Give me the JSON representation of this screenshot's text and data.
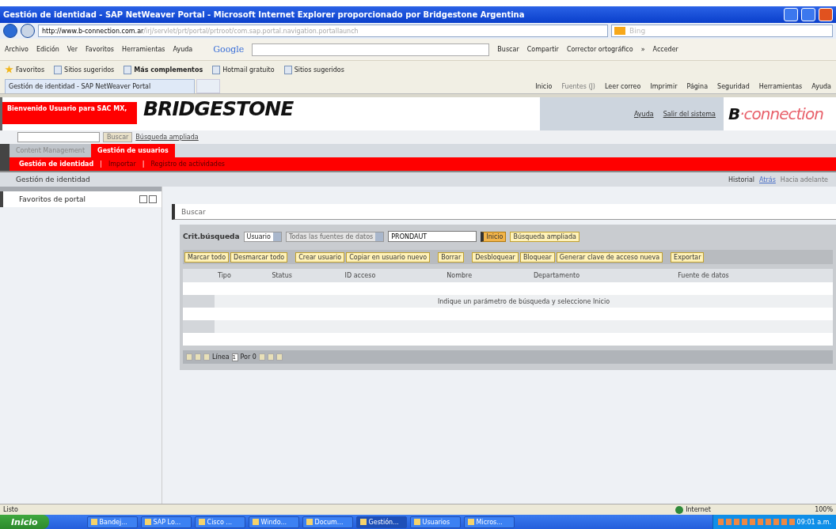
{
  "window": {
    "title": "Gestión de identidad - SAP NetWeaver Portal - Microsoft Internet Explorer proporcionado por Bridgestone Argentina"
  },
  "address_bar": {
    "url_host": "http://www.b-connection.com.ar",
    "url_path": "/irj/servlet/prt/portal/prtroot/com.sap.portal.navigation.portallaunch",
    "search_placeholder": "Bing"
  },
  "menu": [
    "Archivo",
    "Edición",
    "Ver",
    "Favoritos",
    "Herramientas",
    "Ayuda"
  ],
  "google_bar": {
    "brand": "Google",
    "items": [
      "Buscar",
      "Compartir",
      "Corrector ortográfico",
      "»",
      "Acceder"
    ]
  },
  "favorites_bar": [
    {
      "label": "Favoritos",
      "bold": false
    },
    {
      "label": "Sitios sugeridos",
      "bold": false
    },
    {
      "label": "Más complementos",
      "bold": true
    },
    {
      "label": "Hotmail gratuito",
      "bold": false
    },
    {
      "label": "Sitios sugeridos",
      "bold": false
    }
  ],
  "browser_tab": {
    "title": "Gestión de identidad - SAP NetWeaver Portal"
  },
  "command_bar": [
    {
      "label": "Inicio",
      "disabled": false
    },
    {
      "label": "Fuentes (J)",
      "disabled": true
    },
    {
      "label": "Leer correo",
      "disabled": false
    },
    {
      "label": "Imprimir",
      "disabled": false
    },
    {
      "label": "Página",
      "disabled": false
    },
    {
      "label": "Seguridad",
      "disabled": false
    },
    {
      "label": "Herramientas",
      "disabled": false
    },
    {
      "label": "Ayuda",
      "disabled": false
    }
  ],
  "portal_header": {
    "welcome": "Bienvenido Usuario para SAC MX,",
    "logo": "BRIDGESTONE",
    "links": [
      "Ayuda",
      "Salir del sistema"
    ],
    "brand_b": "B",
    "brand_rest": "·connection"
  },
  "portal_search": {
    "button": "Buscar",
    "link": "Búsqueda ampliada"
  },
  "top_tabs": [
    {
      "label": "Content Management",
      "selected": false
    },
    {
      "label": "Gestión de usuarios",
      "selected": true
    }
  ],
  "sub_tab_separator": "|",
  "sub_tabs": [
    {
      "label": "Gestión de identidad",
      "selected": true
    },
    {
      "label": "Importar",
      "selected": false
    },
    {
      "label": "Registro de actividades",
      "selected": false
    }
  ],
  "page_title": "Gestión de identidad",
  "history": [
    {
      "label": "Historial",
      "disabled": false
    },
    {
      "label": "Atrás",
      "disabled": false
    },
    {
      "label": "Hacia adelante",
      "disabled": true
    }
  ],
  "sidebar": {
    "title": "Favoritos de portal"
  },
  "search_panel": {
    "title": "Buscar",
    "criteria_label": "Crit.búsqueda",
    "type": "Usuario",
    "source": "Todas las fuentes de datos",
    "value": "PRONDAUT",
    "go": "Inicio",
    "advanced": "Búsqueda ampliada"
  },
  "actions": [
    [
      "Marcar todo",
      "Desmarcar todo"
    ],
    [
      "Crear usuario",
      "Copiar en usuario nuevo"
    ],
    [
      "Borrar"
    ],
    [
      "Desbloquear",
      "Bloquear",
      "Generar clave de acceso nueva"
    ],
    [
      "Exportar"
    ]
  ],
  "table": {
    "columns": [
      "Tipo",
      "Status",
      "ID acceso",
      "Nombre",
      "Departamento",
      "Fuente de datos"
    ],
    "message": "Indique un parámetro de búsqueda y seleccione Inicio"
  },
  "pager": {
    "label": "Línea",
    "value": "1",
    "total": "Por 0"
  },
  "status_bar": {
    "text": "Listo",
    "zone": "Internet",
    "zoom": "100%"
  },
  "taskbar": {
    "start": "Inicio",
    "items": [
      {
        "label": "Bandej...",
        "selected": false
      },
      {
        "label": "SAP Lo...",
        "selected": false
      },
      {
        "label": "Cisco ...",
        "selected": false
      },
      {
        "label": "Windo...",
        "selected": false
      },
      {
        "label": "Docum...",
        "selected": false
      },
      {
        "label": "Gestión...",
        "selected": true
      },
      {
        "label": "Usuarios",
        "selected": false
      },
      {
        "label": "Micros...",
        "selected": false
      }
    ],
    "clock": "09:01 a.m."
  }
}
